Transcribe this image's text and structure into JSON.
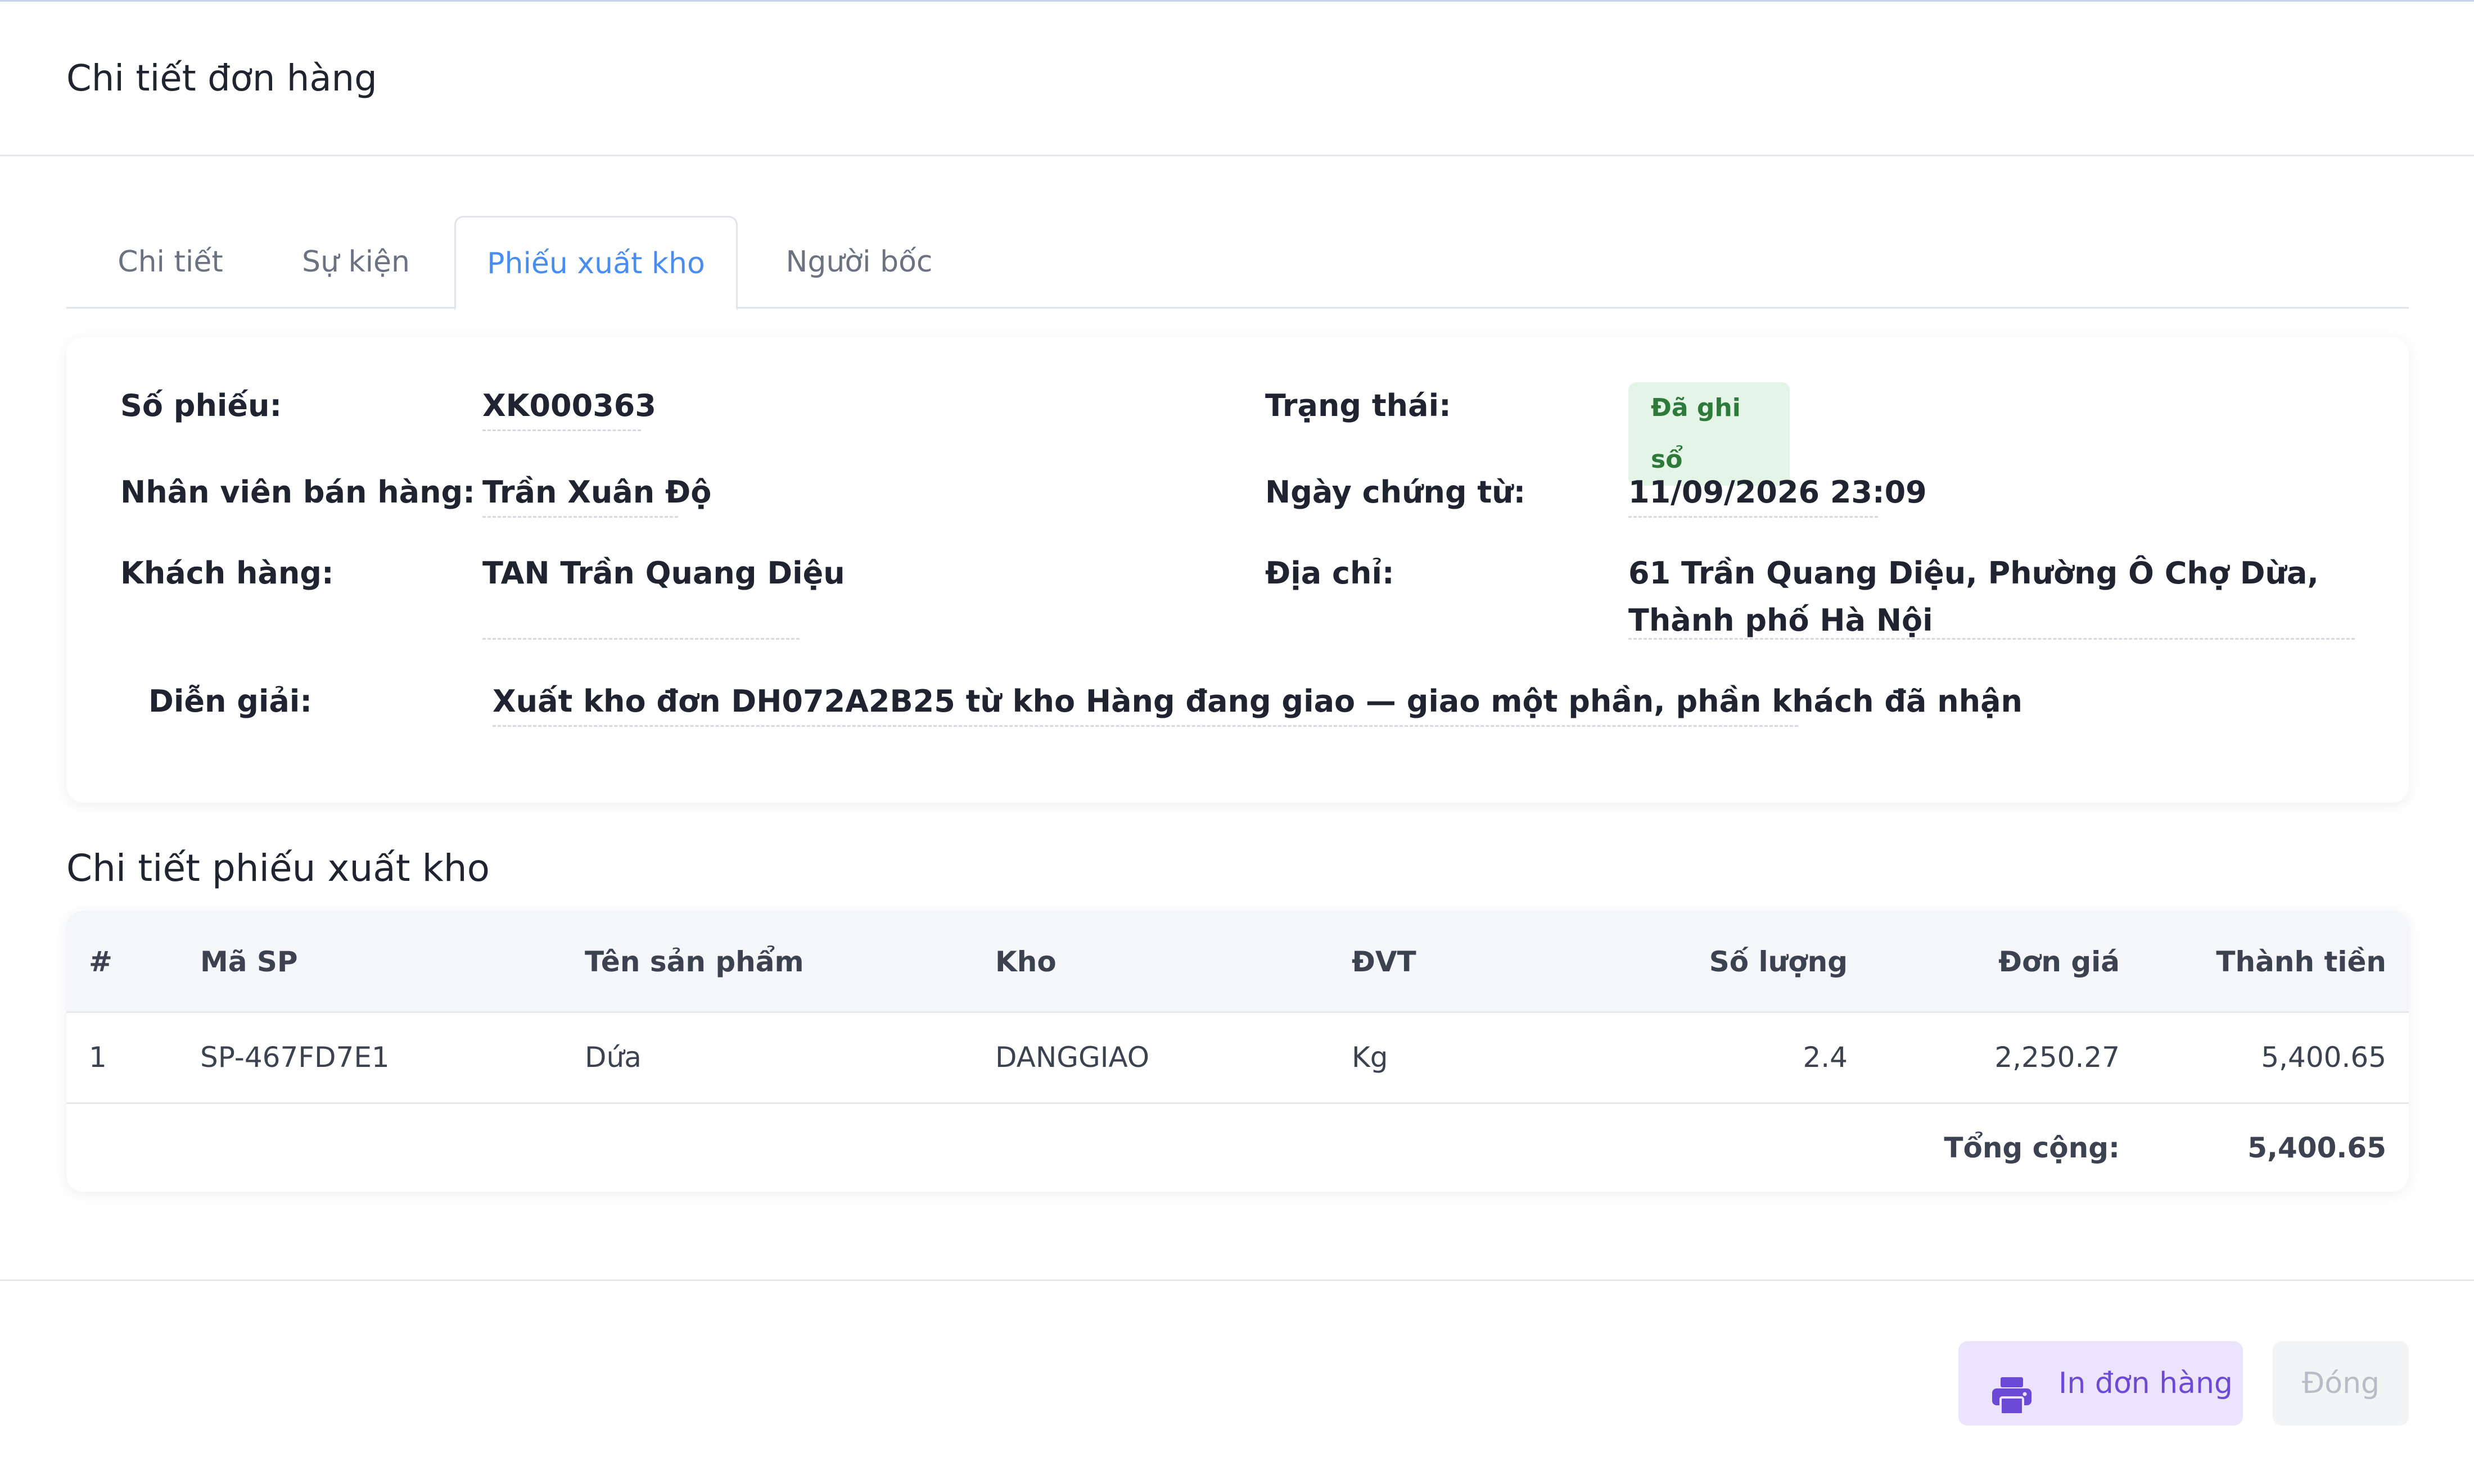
{
  "modal": {
    "title": "Chi tiết đơn hàng"
  },
  "tabs": [
    {
      "label": "Chi tiết",
      "active": false
    },
    {
      "label": "Sự kiện",
      "active": false
    },
    {
      "label": "Phiếu xuất kho",
      "active": true
    },
    {
      "label": "Người bốc",
      "active": false
    }
  ],
  "info": {
    "so_phieu_label": "Số phiếu:",
    "so_phieu": "XK000363",
    "trang_thai_label": "Trạng thái:",
    "trang_thai": "Đã ghi sổ",
    "nhan_vien_label": "Nhân viên bán hàng:",
    "nhan_vien": "Trần Xuân Độ",
    "ngay_label": "Ngày chứng từ:",
    "ngay": "11/09/2026 23:09",
    "khach_hang_label": "Khách hàng:",
    "khach_hang": "TAN Trần Quang Diệu",
    "dia_chi_label": "Địa chỉ:",
    "dia_chi": "61 Trần Quang Diệu, Phường Ô Chợ Dừa, Thành phố Hà Nội",
    "dien_giai_label": "Diễn giải:",
    "dien_giai": "Xuất kho đơn DH072A2B25 từ kho Hàng đang giao — giao một phần, phần khách đã nhận"
  },
  "section_title": "Chi tiết phiếu xuất kho",
  "table": {
    "headers": [
      "#",
      "Mã SP",
      "Tên sản phẩm",
      "Kho",
      "ĐVT",
      "Số lượng",
      "Đơn giá",
      "Thành tiền"
    ],
    "rows": [
      [
        "1",
        "SP-467FD7E1",
        "Dứa",
        "DANGGIAO",
        "Kg",
        "2.4",
        "2,250.27",
        "5,400.65"
      ]
    ],
    "total_label": "Tổng cộng:",
    "total_value": "5,400.65"
  },
  "footer": {
    "print_label": "In đơn hàng",
    "close_label": "Đóng",
    "print_icon": "printer-icon"
  },
  "colors": {
    "active_tab": "#4a8df0",
    "badge_bg": "#e4f4e6",
    "badge_text": "#2d7a3a",
    "print_bg": "#ece4ff",
    "print_text": "#6d4ad6"
  }
}
